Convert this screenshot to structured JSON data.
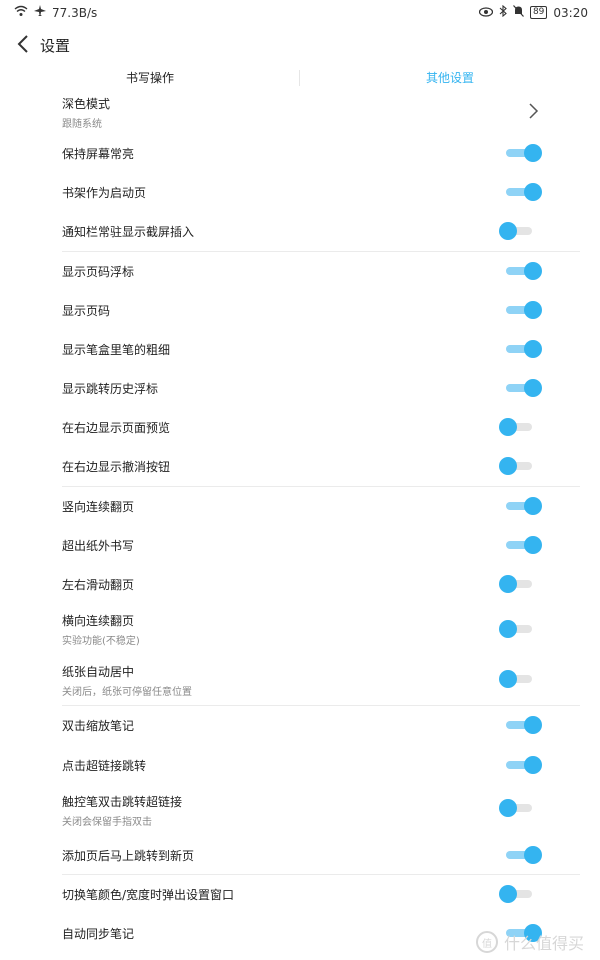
{
  "status_bar": {
    "net_speed": "77.3B/s",
    "battery": "89",
    "time": "03:20",
    "icons": [
      "wifi-icon",
      "airplane-icon",
      "eye-icon",
      "bluetooth-icon",
      "mute-bell-icon",
      "battery-icon"
    ]
  },
  "header": {
    "title": "设置"
  },
  "tabs": [
    {
      "label": "书写操作",
      "active": false
    },
    {
      "label": "其他设置",
      "active": true
    }
  ],
  "colors": {
    "accent": "#34b4f0",
    "track_on": "#8fd3f6",
    "track_off": "#e4e4e4"
  },
  "settings": [
    {
      "label": "深色模式",
      "sub": "跟随系统",
      "control": "chevron"
    },
    {
      "label": "保持屏幕常亮",
      "control": "toggle",
      "on": true
    },
    {
      "label": "书架作为启动页",
      "control": "toggle",
      "on": true
    },
    {
      "label": "通知栏常驻显示截屏插入",
      "control": "toggle",
      "on": false
    },
    {
      "label": "显示页码浮标",
      "control": "toggle",
      "on": true
    },
    {
      "label": "显示页码",
      "control": "toggle",
      "on": true
    },
    {
      "label": "显示笔盒里笔的粗细",
      "control": "toggle",
      "on": true
    },
    {
      "label": "显示跳转历史浮标",
      "control": "toggle",
      "on": true
    },
    {
      "label": "在右边显示页面预览",
      "control": "toggle",
      "on": false
    },
    {
      "label": "在右边显示撤消按钮",
      "control": "toggle",
      "on": false
    },
    {
      "label": "竖向连续翻页",
      "control": "toggle",
      "on": true
    },
    {
      "label": "超出纸外书写",
      "control": "toggle",
      "on": true
    },
    {
      "label": "左右滑动翻页",
      "control": "toggle",
      "on": false
    },
    {
      "label": "横向连续翻页",
      "sub": "实验功能(不稳定)",
      "control": "toggle",
      "on": false
    },
    {
      "label": "纸张自动居中",
      "sub": "关闭后，纸张可停留任意位置",
      "control": "toggle",
      "on": false
    },
    {
      "label": "双击缩放笔记",
      "control": "toggle",
      "on": true
    },
    {
      "label": "点击超链接跳转",
      "control": "toggle",
      "on": true
    },
    {
      "label": "触控笔双击跳转超链接",
      "sub": "关闭会保留手指双击",
      "control": "toggle",
      "on": false
    },
    {
      "label": "添加页后马上跳转到新页",
      "control": "toggle",
      "on": true
    },
    {
      "label": "切换笔颜色/宽度时弹出设置窗口",
      "control": "toggle",
      "on": false
    },
    {
      "label": "自动同步笔记",
      "control": "toggle",
      "on": true
    }
  ],
  "watermark": {
    "glyph": "值",
    "text": "什么值得买"
  }
}
